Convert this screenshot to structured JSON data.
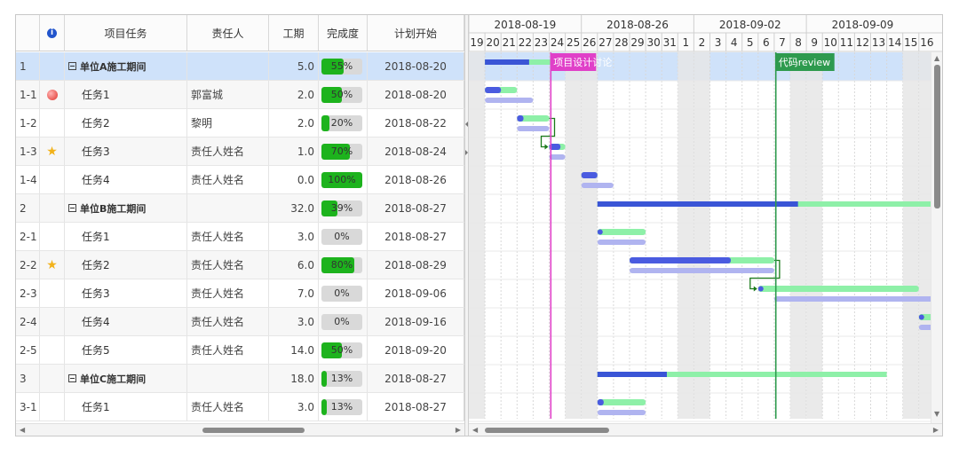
{
  "columns": [
    "项目任务",
    "责任人",
    "工期",
    "完成度",
    "计划开始"
  ],
  "header_icon": "info-icon",
  "rows": [
    {
      "id": "1",
      "task": "单位A施工期间",
      "owner": "",
      "duration": "5.0",
      "progress": 55,
      "progress_label": "55%",
      "start": "2018-08-20",
      "parent": true,
      "icon": ""
    },
    {
      "id": "1-1",
      "task": "任务1",
      "owner": "郭富城",
      "duration": "2.0",
      "progress": 50,
      "progress_label": "50%",
      "start": "2018-08-20",
      "parent": false,
      "icon": "red-dot-icon"
    },
    {
      "id": "1-2",
      "task": "任务2",
      "owner": "黎明",
      "duration": "2.0",
      "progress": 20,
      "progress_label": "20%",
      "start": "2018-08-22",
      "parent": false,
      "icon": ""
    },
    {
      "id": "1-3",
      "task": "任务3",
      "owner": "责任人姓名",
      "duration": "1.0",
      "progress": 70,
      "progress_label": "70%",
      "start": "2018-08-24",
      "parent": false,
      "icon": "star-icon"
    },
    {
      "id": "1-4",
      "task": "任务4",
      "owner": "责任人姓名",
      "duration": "0.0",
      "progress": 100,
      "progress_label": "100%",
      "start": "2018-08-26",
      "parent": false,
      "icon": ""
    },
    {
      "id": "2",
      "task": "单位B施工期间",
      "owner": "",
      "duration": "32.0",
      "progress": 39,
      "progress_label": "39%",
      "start": "2018-08-27",
      "parent": true,
      "icon": ""
    },
    {
      "id": "2-1",
      "task": "任务1",
      "owner": "责任人姓名",
      "duration": "3.0",
      "progress": 0,
      "progress_label": "0%",
      "start": "2018-08-27",
      "parent": false,
      "icon": ""
    },
    {
      "id": "2-2",
      "task": "任务2",
      "owner": "责任人姓名",
      "duration": "6.0",
      "progress": 80,
      "progress_label": "80%",
      "start": "2018-08-29",
      "parent": false,
      "icon": "star-icon"
    },
    {
      "id": "2-3",
      "task": "任务3",
      "owner": "责任人姓名",
      "duration": "7.0",
      "progress": 0,
      "progress_label": "0%",
      "start": "2018-09-06",
      "parent": false,
      "icon": ""
    },
    {
      "id": "2-4",
      "task": "任务4",
      "owner": "责任人姓名",
      "duration": "3.0",
      "progress": 0,
      "progress_label": "0%",
      "start": "2018-09-16",
      "parent": false,
      "icon": ""
    },
    {
      "id": "2-5",
      "task": "任务5",
      "owner": "责任人姓名",
      "duration": "14.0",
      "progress": 50,
      "progress_label": "50%",
      "start": "2018-09-20",
      "parent": false,
      "icon": ""
    },
    {
      "id": "3",
      "task": "单位C施工期间",
      "owner": "",
      "duration": "18.0",
      "progress": 13,
      "progress_label": "13%",
      "start": "2018-08-27",
      "parent": true,
      "icon": ""
    },
    {
      "id": "3-1",
      "task": "任务1",
      "owner": "责任人姓名",
      "duration": "3.0",
      "progress": 13,
      "progress_label": "13%",
      "start": "2018-08-27",
      "parent": false,
      "icon": ""
    }
  ],
  "timeline": {
    "weeks": [
      "2018-08-19",
      "2018-08-26",
      "2018-09-02",
      "2018-09-09"
    ],
    "days": [
      "19",
      "20",
      "21",
      "22",
      "23",
      "24",
      "25",
      "26",
      "27",
      "28",
      "29",
      "30",
      "31",
      "1",
      "2",
      "3",
      "4",
      "5",
      "6",
      "7",
      "8",
      "9",
      "10",
      "11",
      "12",
      "13",
      "14",
      "15",
      "16"
    ],
    "weekend_days": [
      "19",
      "25",
      "26",
      "1",
      "2",
      "8",
      "9",
      "15",
      "16"
    ]
  },
  "milestones": [
    {
      "label": "项目设计讨论",
      "date": "2018-08-24",
      "color": "#e040c8"
    },
    {
      "label": "代码review",
      "date": "2018-09-07",
      "color": "#2e9a4e"
    }
  ],
  "gantt_bars": [
    {
      "row": 0,
      "start": "2018-08-20",
      "duration": 5,
      "progress": 55,
      "parent": true
    },
    {
      "row": 1,
      "start": "2018-08-20",
      "duration": 2,
      "progress": 50,
      "baseline_start": "2018-08-20",
      "baseline_duration": 3
    },
    {
      "row": 2,
      "start": "2018-08-22",
      "duration": 2,
      "progress": 20,
      "baseline_start": "2018-08-22",
      "baseline_duration": 2
    },
    {
      "row": 3,
      "start": "2018-08-24",
      "duration": 1,
      "progress": 70,
      "baseline_start": "2018-08-24",
      "baseline_duration": 1
    },
    {
      "row": 4,
      "start": "2018-08-26",
      "duration": 1,
      "progress": 100,
      "baseline_start": "2018-08-26",
      "baseline_duration": 2
    },
    {
      "row": 5,
      "start": "2018-08-27",
      "duration": 32,
      "progress": 39,
      "parent": true
    },
    {
      "row": 6,
      "start": "2018-08-27",
      "duration": 3,
      "progress": 0,
      "baseline_start": "2018-08-27",
      "baseline_duration": 3
    },
    {
      "row": 7,
      "start": "2018-08-29",
      "duration": 9,
      "progress": 70,
      "baseline_start": "2018-08-29",
      "baseline_duration": 9
    },
    {
      "row": 8,
      "start": "2018-09-06",
      "duration": 10,
      "progress": 0,
      "baseline_start": "2018-09-07",
      "baseline_duration": 10
    },
    {
      "row": 9,
      "start": "2018-09-16",
      "duration": 3,
      "progress": 0,
      "baseline_start": "2018-09-16",
      "baseline_duration": 3
    },
    {
      "row": 10,
      "start": "2018-09-20",
      "duration": 14,
      "progress": 50,
      "baseline_start": "2018-09-20",
      "baseline_duration": 14
    },
    {
      "row": 11,
      "start": "2018-08-27",
      "duration": 18,
      "progress": 24,
      "parent": true
    },
    {
      "row": 12,
      "start": "2018-08-27",
      "duration": 3,
      "progress": 13,
      "baseline_start": "2018-08-27",
      "baseline_duration": 3
    }
  ],
  "dependencies": [
    {
      "from_row": 2,
      "to_row": 3
    },
    {
      "from_row": 7,
      "to_row": 8
    }
  ],
  "colors": {
    "selected_row": "#cfe2fa",
    "progress_green": "#1db31d",
    "bar_progress": "#4a5be0",
    "bar_remaining": "#8ef0a8",
    "baseline": "#b0b4f0",
    "parent_bar_progress": "#3a55d6",
    "weekend": "#e6e6e6",
    "dependency": "#1a7a1a"
  }
}
